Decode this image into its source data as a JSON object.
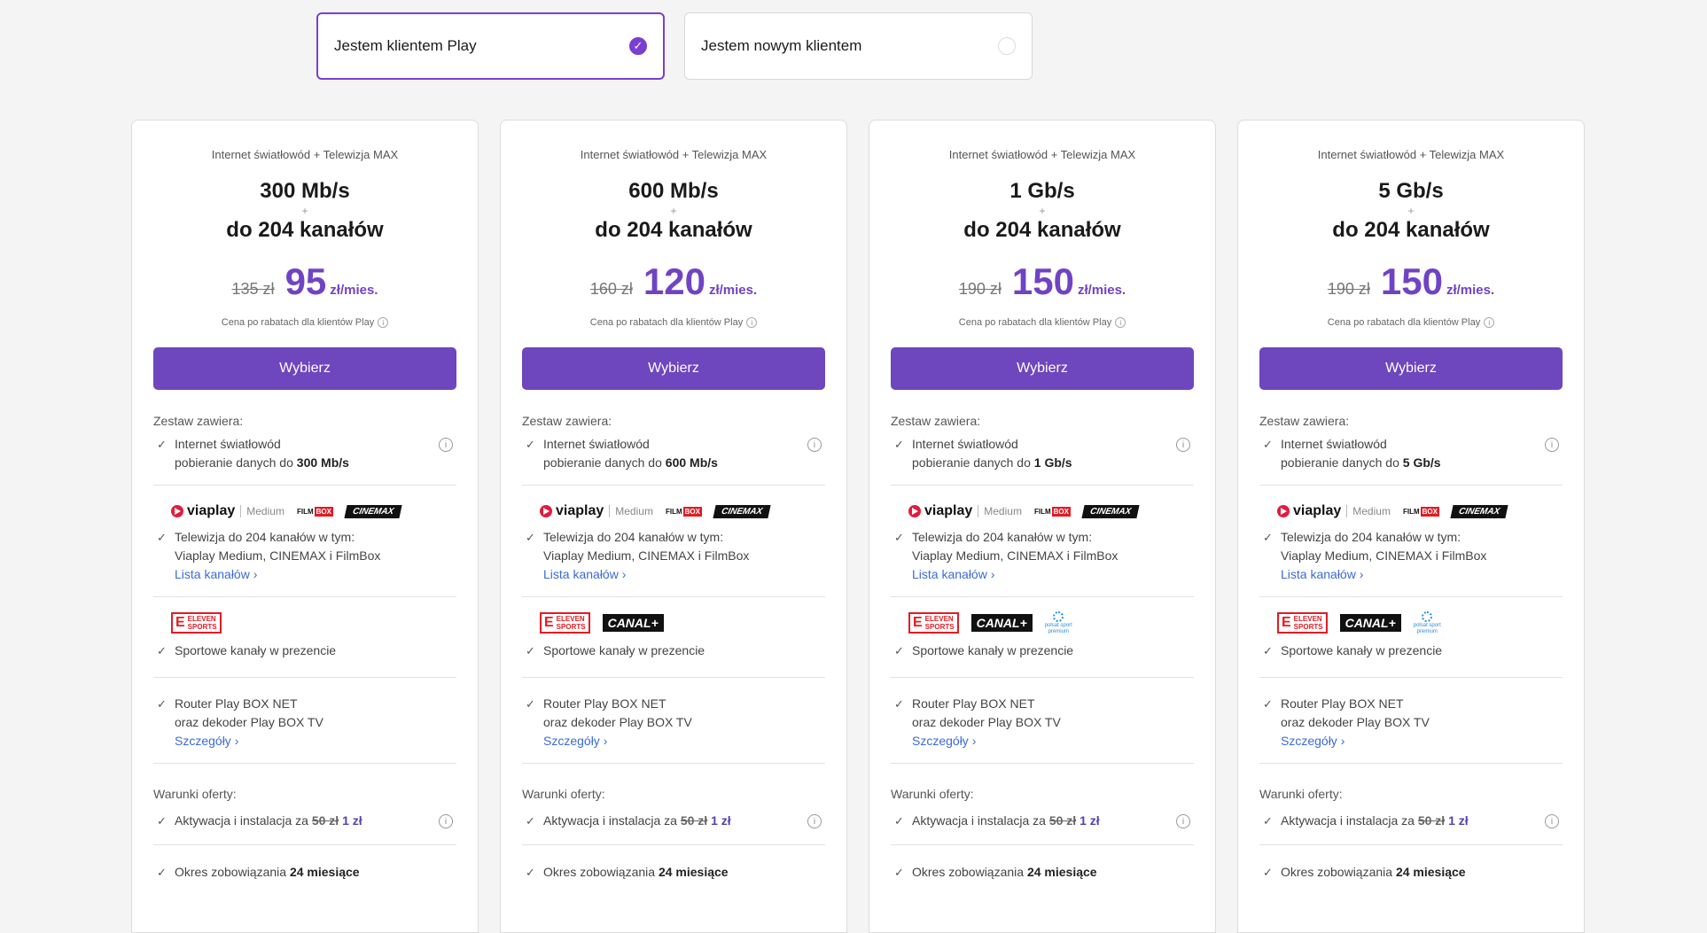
{
  "toggles": [
    {
      "label": "Jestem klientem Play",
      "selected": true,
      "check": "✓"
    },
    {
      "label": "Jestem nowym klientem",
      "selected": false
    }
  ],
  "common": {
    "subtitle": "Internet światłowód + Telewizja MAX",
    "plus": "+",
    "channels": "do 204 kanałów",
    "unit": "zł/mies.",
    "note": "Cena po rabatach dla klientów Play",
    "button": "Wybierz",
    "included_label": "Zestaw zawiera:",
    "internet_line1": "Internet światłowód",
    "internet_line2_prefix": "pobieranie danych do",
    "tv_line1": "Telewizja do 204 kanałów w tym:",
    "tv_line2": "Viaplay Medium, CINEMAX i FilmBox",
    "tv_link": "Lista kanałów ›",
    "sport": "Sportowe kanały w prezencie",
    "router_line1": "Router Play BOX NET",
    "router_line2": "oraz dekoder Play BOX TV",
    "router_link": "Szczegóły ›",
    "terms_label": "Warunki oferty:",
    "activation_prefix": "Aktywacja i instalacja za",
    "activation_old": "50 zł",
    "activation_new": "1 zł",
    "commitment_prefix": "Okres zobowiązania",
    "commitment_value": "24 miesiące",
    "info_icon": "i",
    "check_icon": "✓",
    "logos": {
      "viaplay": "viaplay",
      "medium": "Medium",
      "filmbox_a": "FILM",
      "filmbox_b": "BOX",
      "cinemax": "CINEMAX",
      "eleven_e": "E",
      "eleven_a": "ELEVEN",
      "eleven_b": "SPORTS",
      "canal": "CANAL+",
      "polsat_a": "polsat sport",
      "polsat_b": "premium"
    }
  },
  "plans": [
    {
      "speed": "300 Mb/s",
      "old_price": "135 zł",
      "new_price": "95",
      "speed_bold": "300 Mb/s",
      "polsat": false
    },
    {
      "speed": "600 Mb/s",
      "old_price": "160 zł",
      "new_price": "120",
      "speed_bold": "600 Mb/s",
      "polsat": false
    },
    {
      "speed": "1 Gb/s",
      "old_price": "190 zł",
      "new_price": "150",
      "speed_bold": "1 Gb/s",
      "polsat": true
    },
    {
      "speed": "5 Gb/s",
      "old_price": "190 zł",
      "new_price": "150",
      "speed_bold": "5 Gb/s",
      "polsat": true
    }
  ],
  "colors": {
    "accent": "#6e46be",
    "price": "#7043c4",
    "link": "#3d6ad6"
  }
}
